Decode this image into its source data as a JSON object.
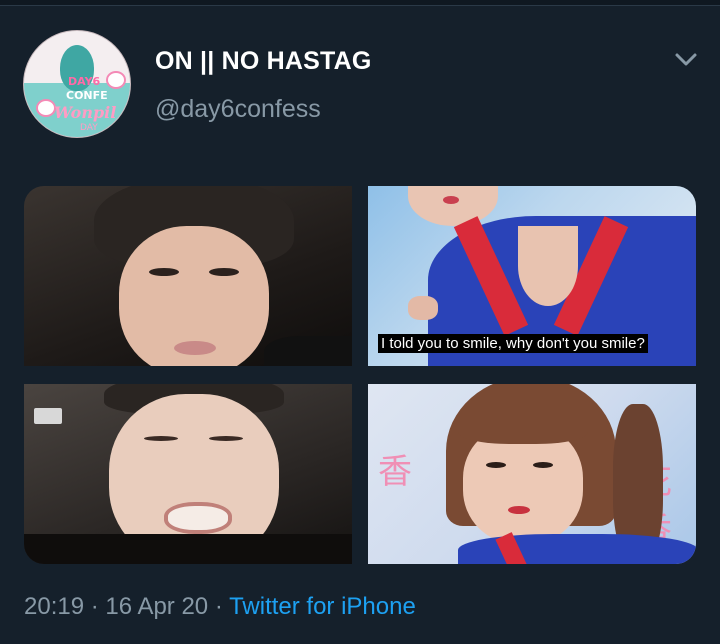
{
  "tweet": {
    "display_name": "ON || NO HASTAG",
    "handle": "@day6confess",
    "avatar_text": {
      "line1": "DAY6",
      "line2": "CONFE",
      "line3": "Wonpil",
      "line4": "DAY"
    },
    "media": [
      {
        "label": ""
      },
      {
        "label": "",
        "caption": "I told you to smile, why don't you smile?"
      },
      {
        "label": ""
      },
      {
        "label": "",
        "sign_text": "香",
        "sign_text2": "花香"
      }
    ],
    "time": "20:19",
    "date": "16 Apr 20",
    "separator": "·",
    "client": "Twitter for iPhone"
  },
  "colors": {
    "background": "#15202b",
    "primary_text": "#ffffff",
    "secondary_text": "#8899a6",
    "link": "#1da1f2"
  },
  "icons": {
    "more": "chevron-down-icon"
  }
}
